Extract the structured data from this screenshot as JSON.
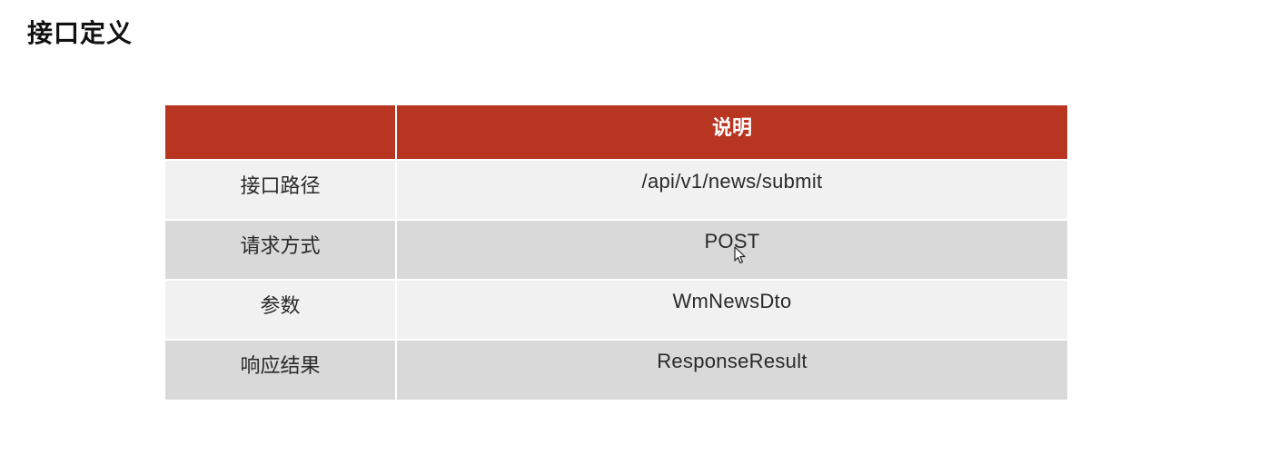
{
  "page": {
    "title": "接口定义"
  },
  "table": {
    "header": {
      "label_col": "",
      "value_col": "说明"
    },
    "rows": [
      {
        "label": "接口路径",
        "value": "/api/v1/news/submit"
      },
      {
        "label": "请求方式",
        "value": "POST"
      },
      {
        "label": "参数",
        "value": "WmNewsDto"
      },
      {
        "label": "响应结果",
        "value": "ResponseResult"
      }
    ],
    "colors": {
      "header_bg": "#b83522",
      "row_light": "#f1f1f1",
      "row_dark": "#d9d9d9"
    }
  },
  "cursor": {
    "icon": "mouse-pointer-icon"
  }
}
